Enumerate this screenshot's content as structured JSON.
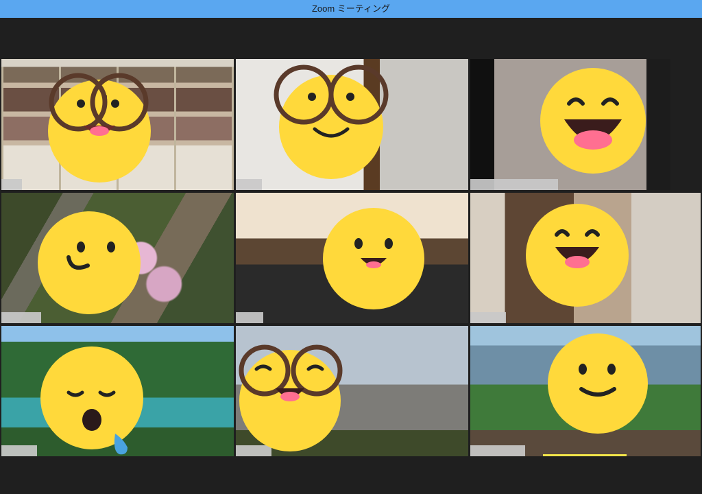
{
  "window": {
    "title": "Zoom ミーティング"
  },
  "colors": {
    "titlebar": "#5aa7f0",
    "active_speaker": "#e8e86a",
    "emoji_face": "#ffd93b",
    "glasses": "#5a3a2a"
  },
  "participants": [
    {
      "tile": "tile-1",
      "emoji": "smiling-face-with-glasses-icon",
      "active": true
    },
    {
      "tile": "tile-2",
      "emoji": "smiling-face-with-glasses-icon",
      "active": false
    },
    {
      "tile": "tile-3",
      "emoji": "grinning-face-icon",
      "active": false
    },
    {
      "tile": "tile-4",
      "emoji": "smirking-face-icon",
      "active": false
    },
    {
      "tile": "tile-5",
      "emoji": "happy-face-icon",
      "active": false
    },
    {
      "tile": "tile-6",
      "emoji": "grinning-face-icon",
      "active": false
    },
    {
      "tile": "tile-7",
      "emoji": "sleepy-face-icon",
      "active": false
    },
    {
      "tile": "tile-8",
      "emoji": "smiling-face-with-glasses-icon",
      "active": false
    },
    {
      "tile": "tile-9",
      "emoji": "slightly-smiling-face-icon",
      "active": false
    }
  ]
}
